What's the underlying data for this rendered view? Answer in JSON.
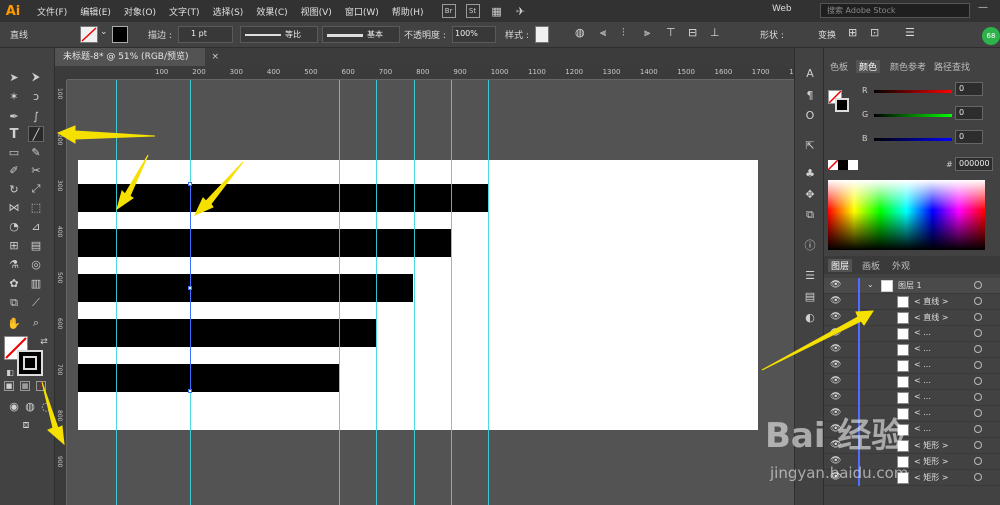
{
  "app": {
    "logo": "Ai"
  },
  "menu": [
    "文件(F)",
    "编辑(E)",
    "对象(O)",
    "文字(T)",
    "选择(S)",
    "效果(C)",
    "视图(V)",
    "窗口(W)",
    "帮助(H)"
  ],
  "menubar_icons": [
    "Br",
    "St"
  ],
  "workspace": "Web",
  "stock_search": {
    "placeholder": "搜索 Adobe Stock"
  },
  "control": {
    "object_label": "直线",
    "stroke_label": "描边 :",
    "stroke_value": "1 pt",
    "profile_uniform": "等比",
    "brush_basic": "基本",
    "opacity_label": "不透明度 :",
    "opacity_value": "100%",
    "style_label": "样式 :",
    "shape_label": "形状 :",
    "transform_label": "变换"
  },
  "document_tab": {
    "title": "未标题-8* @ 51% (RGB/预览)"
  },
  "ruler_h": [
    "100",
    "200",
    "300",
    "400",
    "500",
    "600",
    "700",
    "800",
    "900",
    "1000",
    "1100",
    "1200",
    "1300",
    "1400",
    "1500",
    "1600",
    "1700",
    "1800"
  ],
  "ruler_v": [
    "100",
    "200",
    "300",
    "400",
    "500",
    "600",
    "700",
    "800",
    "900"
  ],
  "panels": {
    "tabs_top": [
      "色板",
      "颜色",
      "颜色参考",
      "路径查找"
    ],
    "active_top": "颜色",
    "color": {
      "r_label": "R",
      "r_value": "0",
      "g_label": "G",
      "g_value": "0",
      "b_label": "B",
      "b_value": "0",
      "hex_symbol": "#",
      "hex_value": "000000"
    },
    "tabs_layers": [
      "图层",
      "画板",
      "外观"
    ],
    "active_layers": "图层",
    "layers": [
      {
        "name": "图层 1",
        "level": 0
      },
      {
        "name": "< 直线 >",
        "level": 1
      },
      {
        "name": "< 直线 >",
        "level": 1
      },
      {
        "name": "< ...",
        "level": 1
      },
      {
        "name": "< ...",
        "level": 1
      },
      {
        "name": "< ...",
        "level": 1
      },
      {
        "name": "< ...",
        "level": 1
      },
      {
        "name": "< ...",
        "level": 1
      },
      {
        "name": "< ...",
        "level": 1
      },
      {
        "name": "< ...",
        "level": 1
      },
      {
        "name": "< 矩形 >",
        "level": 1
      },
      {
        "name": "< 矩形 >",
        "level": 1
      },
      {
        "name": "< 矩形 >",
        "level": 1
      }
    ]
  },
  "colors": {
    "menubar_bg": "#323232",
    "panel_bg": "#424242",
    "canvas_bg": "#535353",
    "guide": "#39d7e0",
    "selection": "#3a6fff",
    "layer_accent": "#4f6dff",
    "annotation_arrow": "#f5e000"
  },
  "watermark": {
    "brand": "Bai 经验",
    "url": "jingyan.baidu.com"
  },
  "user_badge": "68"
}
